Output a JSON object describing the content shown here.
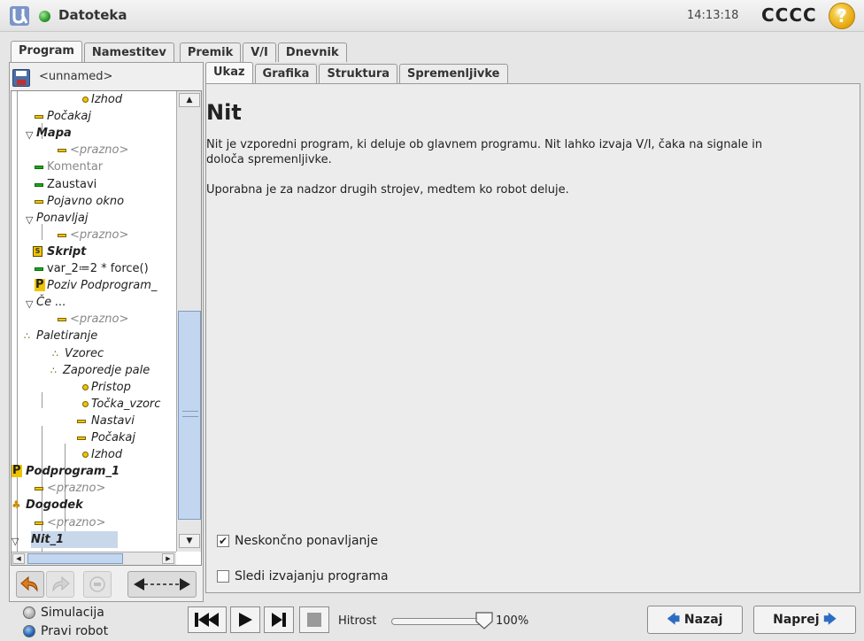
{
  "header": {
    "app_title": "Datoteka",
    "clock": "14:13:18",
    "robot_name": "CCCC",
    "help_label": "?"
  },
  "main_tabs": [
    {
      "label": "Program",
      "active": true
    },
    {
      "label": "Namestitev",
      "active": false
    },
    {
      "label": "Premik",
      "active": false
    },
    {
      "label": "V/I",
      "active": false
    },
    {
      "label": "Dnevnik",
      "active": false
    }
  ],
  "program": {
    "name": "<unnamed>"
  },
  "tree": [
    {
      "label": "Izhod",
      "icon": "waypoint-dot-icon"
    },
    {
      "label": "Počakaj",
      "icon": "command-bar-icon"
    },
    {
      "label": "Mapa",
      "icon": "folder-triangle-icon"
    },
    {
      "label": "<prazno>",
      "icon": "command-bar-icon"
    },
    {
      "label": "Komentar",
      "icon": "comment-bar-icon"
    },
    {
      "label": "Zaustavi",
      "icon": "stop-bar-icon"
    },
    {
      "label": "Pojavno okno",
      "icon": "command-bar-icon"
    },
    {
      "label": "Ponavljaj",
      "icon": "loop-triangle-icon"
    },
    {
      "label": "<prazno>",
      "icon": "command-bar-icon"
    },
    {
      "label": "Skript",
      "icon": "script-icon"
    },
    {
      "label": "var_2≔2 * force()",
      "icon": "assignment-bar-icon"
    },
    {
      "label": "Poziv Podprogram_",
      "icon": "subprogram-call-icon"
    },
    {
      "label": "Če ...",
      "icon": "if-triangle-icon"
    },
    {
      "label": "<prazno>",
      "icon": "command-bar-icon"
    },
    {
      "label": "Paletiranje",
      "icon": "pallet-icon"
    },
    {
      "label": "Vzorec",
      "icon": "pattern-icon"
    },
    {
      "label": "Zaporedje pale",
      "icon": "pallet-sequence-icon"
    },
    {
      "label": "Pristop",
      "icon": "waypoint-dot-icon"
    },
    {
      "label": "Točka_vzorc",
      "icon": "waypoint-dot-icon"
    },
    {
      "label": "Nastavi",
      "icon": "command-bar-icon"
    },
    {
      "label": "Počakaj",
      "icon": "command-bar-icon"
    },
    {
      "label": "Izhod",
      "icon": "waypoint-dot-icon"
    },
    {
      "label": "Podprogram_1",
      "icon": "subprogram-icon"
    },
    {
      "label": "<prazno>",
      "icon": "command-bar-icon"
    },
    {
      "label": "Dogodek",
      "icon": "event-icon"
    },
    {
      "label": "<prazno>",
      "icon": "command-bar-icon"
    },
    {
      "label": "Nit_1",
      "icon": "thread-triangle-icon",
      "selected": true
    }
  ],
  "sub_tabs": [
    {
      "label": "Ukaz",
      "active": true
    },
    {
      "label": "Grafika",
      "active": false
    },
    {
      "label": "Struktura",
      "active": false
    },
    {
      "label": "Spremenljivke",
      "active": false
    }
  ],
  "content": {
    "title": "Nit",
    "description_1": "Nit je vzporedni program, ki deluje ob glavnem programu. Nit lahko izvaja V/I, čaka na signale in",
    "description_1b": "določa spremenljivke.",
    "description_2": "Uporabna je za nadzor drugih strojev, medtem ko robot deluje.",
    "checkbox_loop": {
      "label": "Neskončno ponavljanje",
      "checked": true
    },
    "checkbox_follow": {
      "label": "Sledi izvajanju programa",
      "checked": false
    }
  },
  "bottom": {
    "simulation_label": "Simulacija",
    "real_robot_label": "Pravi robot",
    "speed_label": "Hitrost",
    "speed_value": "100%",
    "speed_fraction": 1.0,
    "back_label": "Nazaj",
    "next_label": "Naprej"
  },
  "colors": {
    "accent_blue": "#2d6cc2",
    "status_green": "#2e9a2a",
    "node_yellow": "#f0c400"
  }
}
